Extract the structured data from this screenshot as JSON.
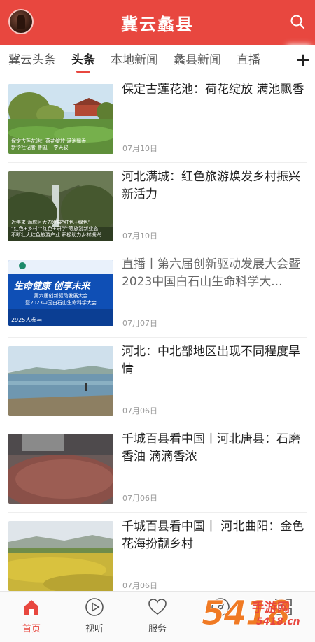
{
  "header": {
    "title": "冀云蠡县",
    "avatar_icon": "app-logo",
    "search_icon": "search-icon",
    "accent": "#e8473f"
  },
  "tabs": [
    {
      "label": "冀云头条",
      "active": false
    },
    {
      "label": "头条",
      "active": true
    },
    {
      "label": "本地新闻",
      "active": false
    },
    {
      "label": "蠡县新闻",
      "active": false
    },
    {
      "label": "直播",
      "active": false
    }
  ],
  "tabs_more": "+",
  "news": [
    {
      "title": "保定古莲花池：荷花绽放 满池飘香",
      "date": "07月10日",
      "thumb_caption": "保定古莲花池：荷花绽放 满池飘香\n新华社记者 曹国厂 李天骏",
      "muted": false
    },
    {
      "title": "河北满城：红色旅游焕发乡村振兴新活力",
      "date": "07月10日",
      "thumb_caption": "近年来 满城区大力发展“红色+绿色”\n“红色+乡村”“红色+研学”等旅游新业态\n不断壮大红色旅游产业 积极助力乡村振兴",
      "muted": false
    },
    {
      "title": "直播丨第六届创新驱动发展大会暨2023中国白石山生命科学大...",
      "date": "07月07日",
      "thumb_caption": "2925人参与",
      "thumb_banner_main": "生命健康 创享未来",
      "thumb_banner_sub": "第六届创新驱动发展大会\n暨2023中国白石山生命科学大会",
      "muted": true
    },
    {
      "title": "河北：中北部地区出现不同程度旱情",
      "date": "07月06日",
      "thumb_caption": "",
      "muted": false
    },
    {
      "title": "千城百县看中国丨河北唐县：石磨香油 滴滴香浓",
      "date": "07月06日",
      "thumb_caption": "",
      "muted": false
    },
    {
      "title": "千城百县看中国丨 河北曲阳：金色花海扮靓乡村",
      "date": "07月06日",
      "thumb_caption": "",
      "muted": false
    }
  ],
  "tabbar": [
    {
      "label": "首页",
      "icon": "home-icon",
      "active": true
    },
    {
      "label": "视听",
      "icon": "play-icon",
      "active": false
    },
    {
      "label": "服务",
      "icon": "heart-icon",
      "active": false
    },
    {
      "label": "",
      "icon": "compass-icon",
      "active": false
    },
    {
      "label": "",
      "icon": "grid-icon",
      "active": false
    }
  ],
  "watermark": {
    "num": "5418",
    "cn": "手游网",
    "url": "5418.cn"
  }
}
